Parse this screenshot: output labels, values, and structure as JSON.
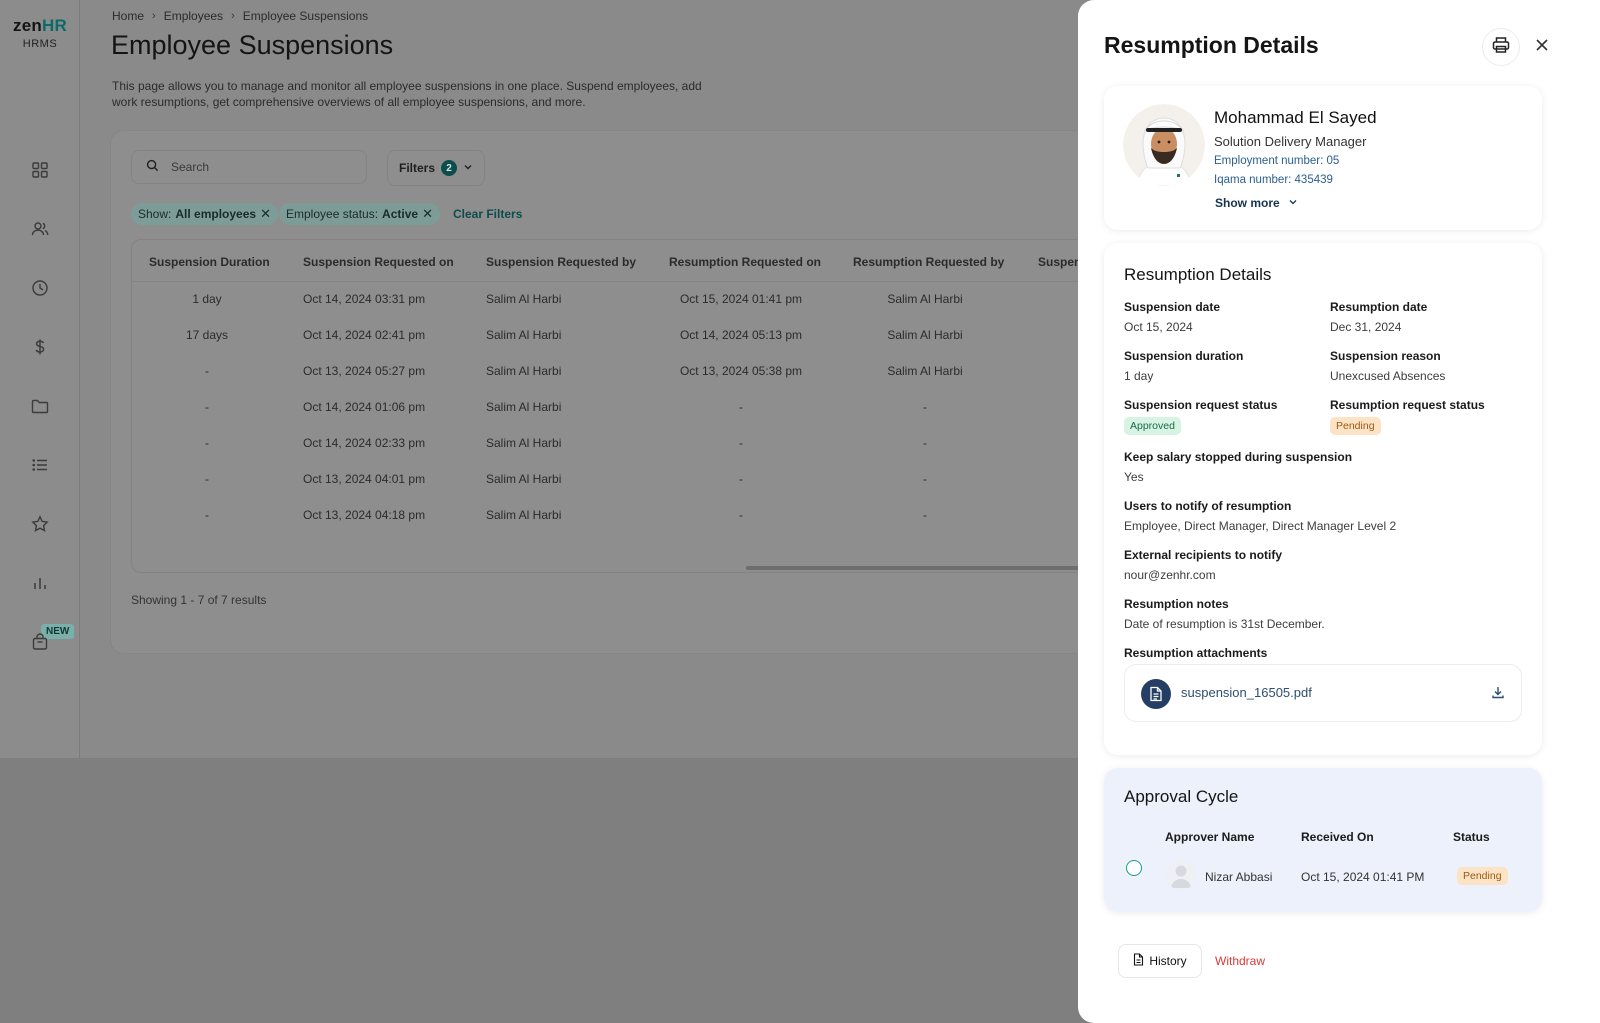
{
  "brand": {
    "logo_main_1": "zen",
    "logo_main_2": "HR",
    "logo_sub": "HRMS",
    "new_badge": "NEW"
  },
  "sidebar_icons": [
    "dashboard-icon",
    "people-icon",
    "clock-icon",
    "dollar-icon",
    "folder-icon",
    "list-icon",
    "star-icon",
    "bar-chart-icon",
    "bag-icon"
  ],
  "breadcrumb": [
    "Home",
    "Employees",
    "Employee Suspensions"
  ],
  "page": {
    "title": "Employee Suspensions",
    "description": "This page allows you to manage and monitor all employee suspensions in one place. Suspend employees, add work resumptions, get comprehensive overviews of all employee suspensions, and more."
  },
  "toolbar": {
    "search_placeholder": "Search",
    "filters_label": "Filters",
    "filters_count": "2",
    "chip1_key": "Show:",
    "chip1_value": "All employees",
    "chip2_key": "Employee status:",
    "chip2_value": "Active",
    "clear_filters": "Clear Filters"
  },
  "table": {
    "headers": [
      "Suspension Duration",
      "Suspension Requested on",
      "Suspension Requested by",
      "Resumption Requested on",
      "Resumption Requested by",
      "Suspen"
    ],
    "rows": [
      [
        "1 day",
        "Oct 14, 2024 03:31 pm",
        "Salim Al Harbi",
        "Oct 15, 2024 01:41 pm",
        "Salim Al Harbi"
      ],
      [
        "17 days",
        "Oct 14, 2024 02:41 pm",
        "Salim Al Harbi",
        "Oct 14, 2024 05:13 pm",
        "Salim Al Harbi"
      ],
      [
        "-",
        "Oct 13, 2024 05:27 pm",
        "Salim Al Harbi",
        "Oct 13, 2024 05:38 pm",
        "Salim Al Harbi"
      ],
      [
        "-",
        "Oct 14, 2024 01:06 pm",
        "Salim Al Harbi",
        "-",
        "-"
      ],
      [
        "-",
        "Oct 14, 2024 02:33 pm",
        "Salim Al Harbi",
        "-",
        "-"
      ],
      [
        "-",
        "Oct 13, 2024 04:01 pm",
        "Salim Al Harbi",
        "-",
        "-"
      ],
      [
        "-",
        "Oct 13, 2024 04:18 pm",
        "Salim Al Harbi",
        "-",
        "-"
      ]
    ],
    "results_text": "Showing 1 - 7 of 7 results"
  },
  "drawer": {
    "title": "Resumption Details",
    "employee": {
      "name": "Mohammad El Sayed",
      "role": "Solution Delivery Manager",
      "employment_number": "Employment number: 05",
      "iqama_number": "Iqama number: 435439",
      "show_more": "Show more"
    },
    "details": {
      "section_title": "Resumption Details",
      "suspension_date_label": "Suspension date",
      "suspension_date": "Oct 15, 2024",
      "resumption_date_label": "Resumption date",
      "resumption_date": "Dec 31, 2024",
      "suspension_duration_label": "Suspension duration",
      "suspension_duration": "1 day",
      "suspension_reason_label": "Suspension reason",
      "suspension_reason": "Unexcused Absences",
      "suspension_status_label": "Suspension request status",
      "suspension_status": "Approved",
      "resumption_status_label": "Resumption request status",
      "resumption_status": "Pending",
      "keep_salary_label": "Keep salary stopped during suspension",
      "keep_salary": "Yes",
      "notify_label": "Users to notify of resumption",
      "notify": "Employee, Direct Manager, Direct Manager Level 2",
      "external_label": "External recipients to notify",
      "external": "nour@zenhr.com",
      "notes_label": "Resumption notes",
      "notes": "Date of resumption is 31st December.",
      "attachments_label": "Resumption attachments",
      "attachment_name": "suspension_16505.pdf"
    },
    "approval": {
      "title": "Approval Cycle",
      "col_name": "Approver Name",
      "col_received": "Received On",
      "col_status": "Status",
      "approver_name": "Nizar Abbasi",
      "received_on": "Oct 15, 2024 01:41 PM",
      "status": "Pending"
    },
    "actions": {
      "history": "History",
      "withdraw": "Withdraw"
    }
  }
}
